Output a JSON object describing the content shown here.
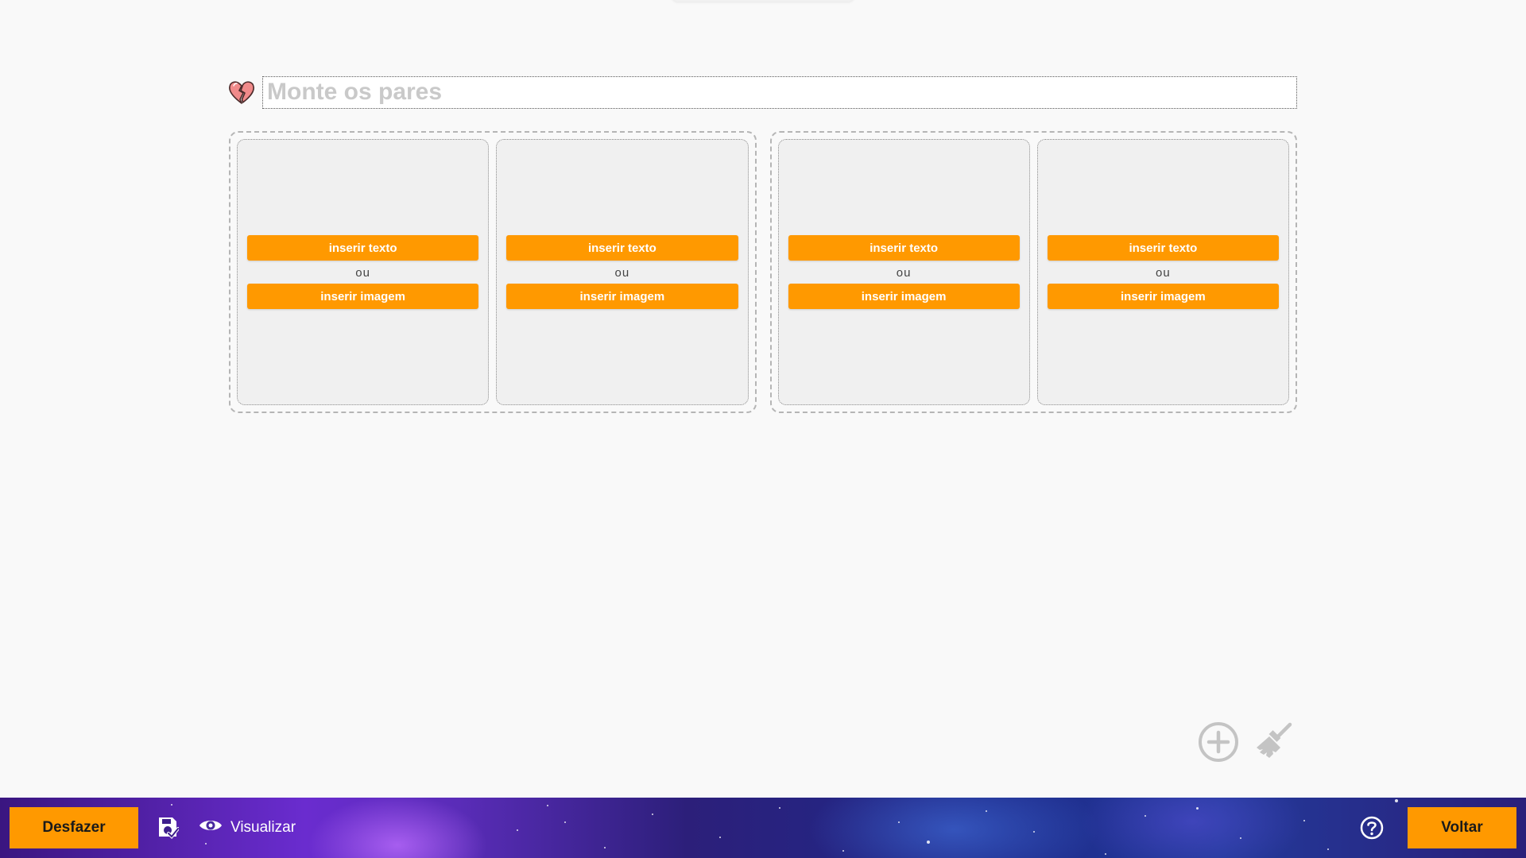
{
  "title": {
    "placeholder": "Monte os pares",
    "value": ""
  },
  "pairs": [
    {
      "cards": [
        {
          "insert_text_label": "inserir texto",
          "or_label": "ou",
          "insert_image_label": "inserir imagem"
        },
        {
          "insert_text_label": "inserir texto",
          "or_label": "ou",
          "insert_image_label": "inserir imagem"
        }
      ]
    },
    {
      "cards": [
        {
          "insert_text_label": "inserir texto",
          "or_label": "ou",
          "insert_image_label": "inserir imagem"
        },
        {
          "insert_text_label": "inserir texto",
          "or_label": "ou",
          "insert_image_label": "inserir imagem"
        }
      ]
    }
  ],
  "tools": {
    "add_icon": "plus-circle-icon",
    "clear_icon": "broom-icon"
  },
  "bottom_bar": {
    "undo_label": "Desfazer",
    "save_icon": "save-check-icon",
    "preview_label": "Visualizar",
    "preview_icon": "eye-icon",
    "help_icon": "question-circle-icon",
    "back_label": "Voltar"
  },
  "colors": {
    "accent": "#ff9900",
    "background": "#f9f9f9",
    "card_background": "#f0f0f0",
    "heart": "#f08a8a"
  }
}
